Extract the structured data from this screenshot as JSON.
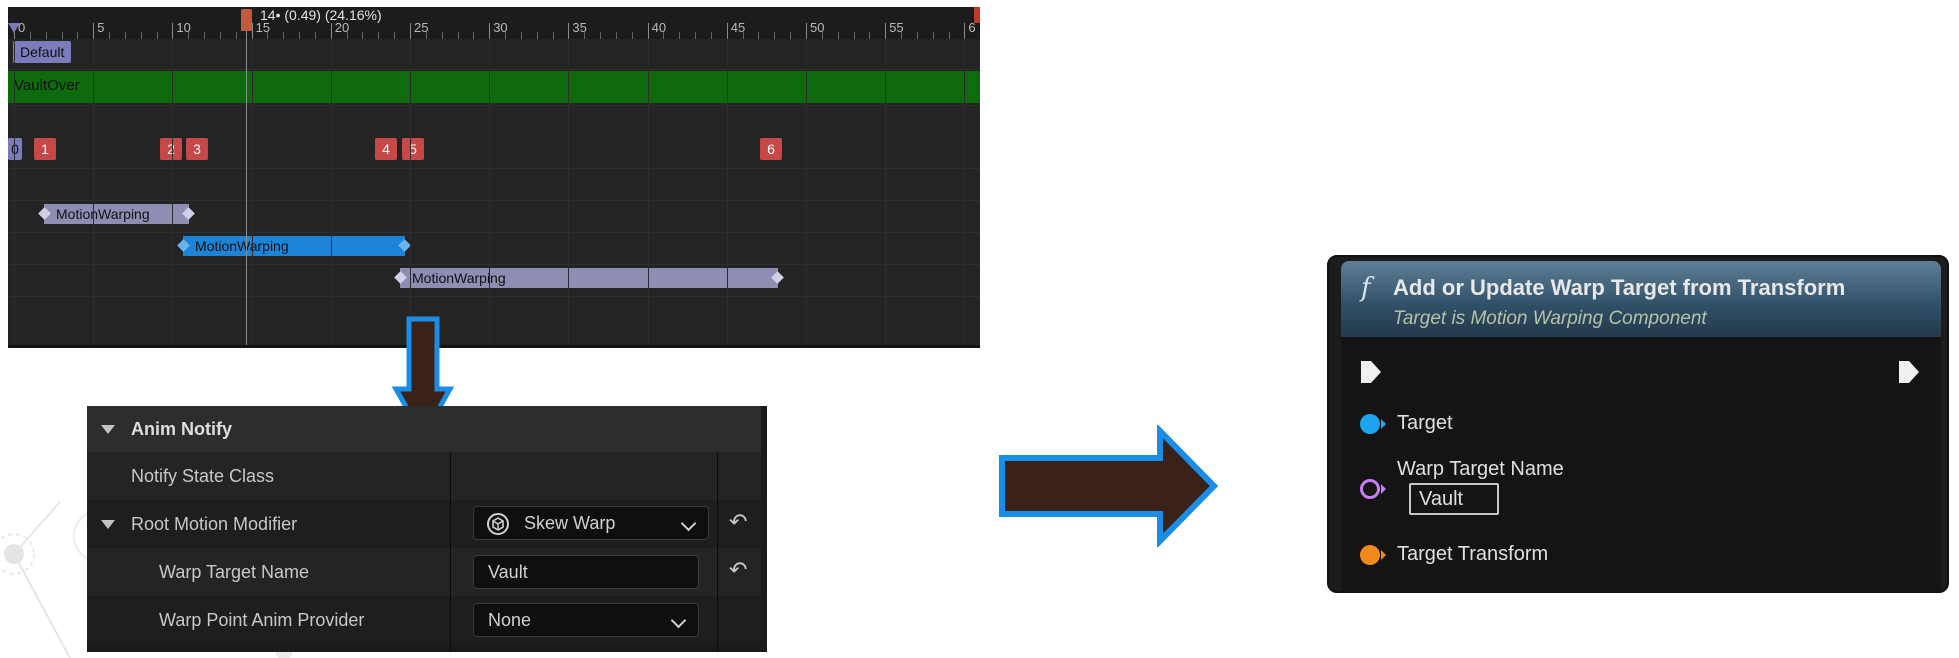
{
  "timeline": {
    "ticks": [
      "0",
      "5",
      "10",
      "15",
      "20",
      "25",
      "30",
      "35",
      "40",
      "45",
      "50",
      "55",
      "6"
    ],
    "scrub_label": "14• (0.49) (24.16%)",
    "default_track": "Default",
    "montage_section": "VaultOver",
    "notifies": [
      "0",
      "1",
      "2",
      "3",
      "4",
      "5",
      "6"
    ],
    "motion_warping_states": [
      "MotionWarping",
      "MotionWarping",
      "MotionWarping"
    ]
  },
  "details": {
    "section_title": "Anim Notify",
    "rows": {
      "notify_state_class": "Notify State Class",
      "root_motion_modifier": "Root Motion Modifier",
      "root_motion_modifier_value": "Skew Warp",
      "warp_target_name": "Warp Target Name",
      "warp_target_name_value": "Vault",
      "warp_point_anim_provider": "Warp Point Anim Provider",
      "warp_point_anim_provider_value": "None"
    },
    "reset_icon": "↶"
  },
  "node": {
    "icon": "f",
    "title": "Add or Update Warp Target from Transform",
    "subtitle": "Target is Motion Warping Component",
    "pins": {
      "target": "Target",
      "warp_target_name": "Warp Target Name",
      "warp_target_name_value": "Vault",
      "target_transform": "Target Transform"
    }
  },
  "colors": {
    "arrow_fill": "#3a2218",
    "arrow_outline": "#1a8ee6",
    "pin_object": "#1aa6f0",
    "pin_name": "#c67ef0",
    "pin_struct": "#f08a1a",
    "montage_track": "#0d6b0d",
    "notify_red": "#c84848"
  }
}
